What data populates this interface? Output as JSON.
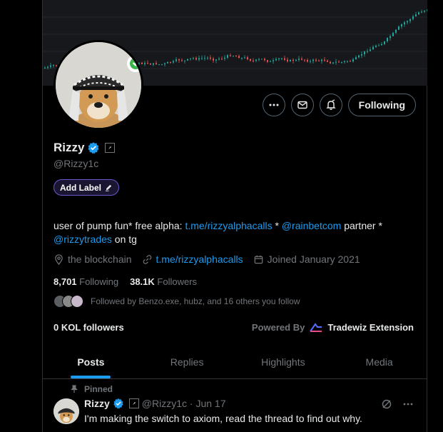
{
  "profile": {
    "name": "Rizzy",
    "handle": "@Rizzy1c",
    "add_label": "Add Label",
    "bio": {
      "text_1": "user of pump fun* free alpha: ",
      "link_1": "t.me/rizzyalphacalls",
      "text_2": " * ",
      "link_2": "@rainbetcom",
      "text_3": " partner * ",
      "link_3": "@rizzytrades",
      "text_4": " on tg"
    },
    "location": "the blockchain",
    "website": "t.me/rizzyalphacalls",
    "joined": "Joined January 2021"
  },
  "actions": {
    "more_icon": "more-icon",
    "message_icon": "mail-icon",
    "notify_icon": "bell-icon",
    "follow_label": "Following"
  },
  "stats": {
    "following_count": "8,701",
    "following_label": "Following",
    "followers_count": "38.1K",
    "followers_label": "Followers"
  },
  "followed_by": "Followed by Benzo.exe, hubz, and 16 others you follow",
  "kol": "0 KOL followers",
  "powered_by": {
    "label": "Powered By",
    "brand": "Tradewiz Extension"
  },
  "tabs": [
    "Posts",
    "Replies",
    "Highlights",
    "Media"
  ],
  "pinned_post": {
    "pinned_label": "Pinned",
    "name": "Rizzy",
    "handle_date": "@Rizzy1c · Jun 17",
    "text": "I'm making the switch to axiom, read the thread to find out why."
  },
  "colors": {
    "accent": "#1d9bf0",
    "label_border": "#6e56cf",
    "chart_up": "#26a69a",
    "chart_down": "#ef5350"
  }
}
